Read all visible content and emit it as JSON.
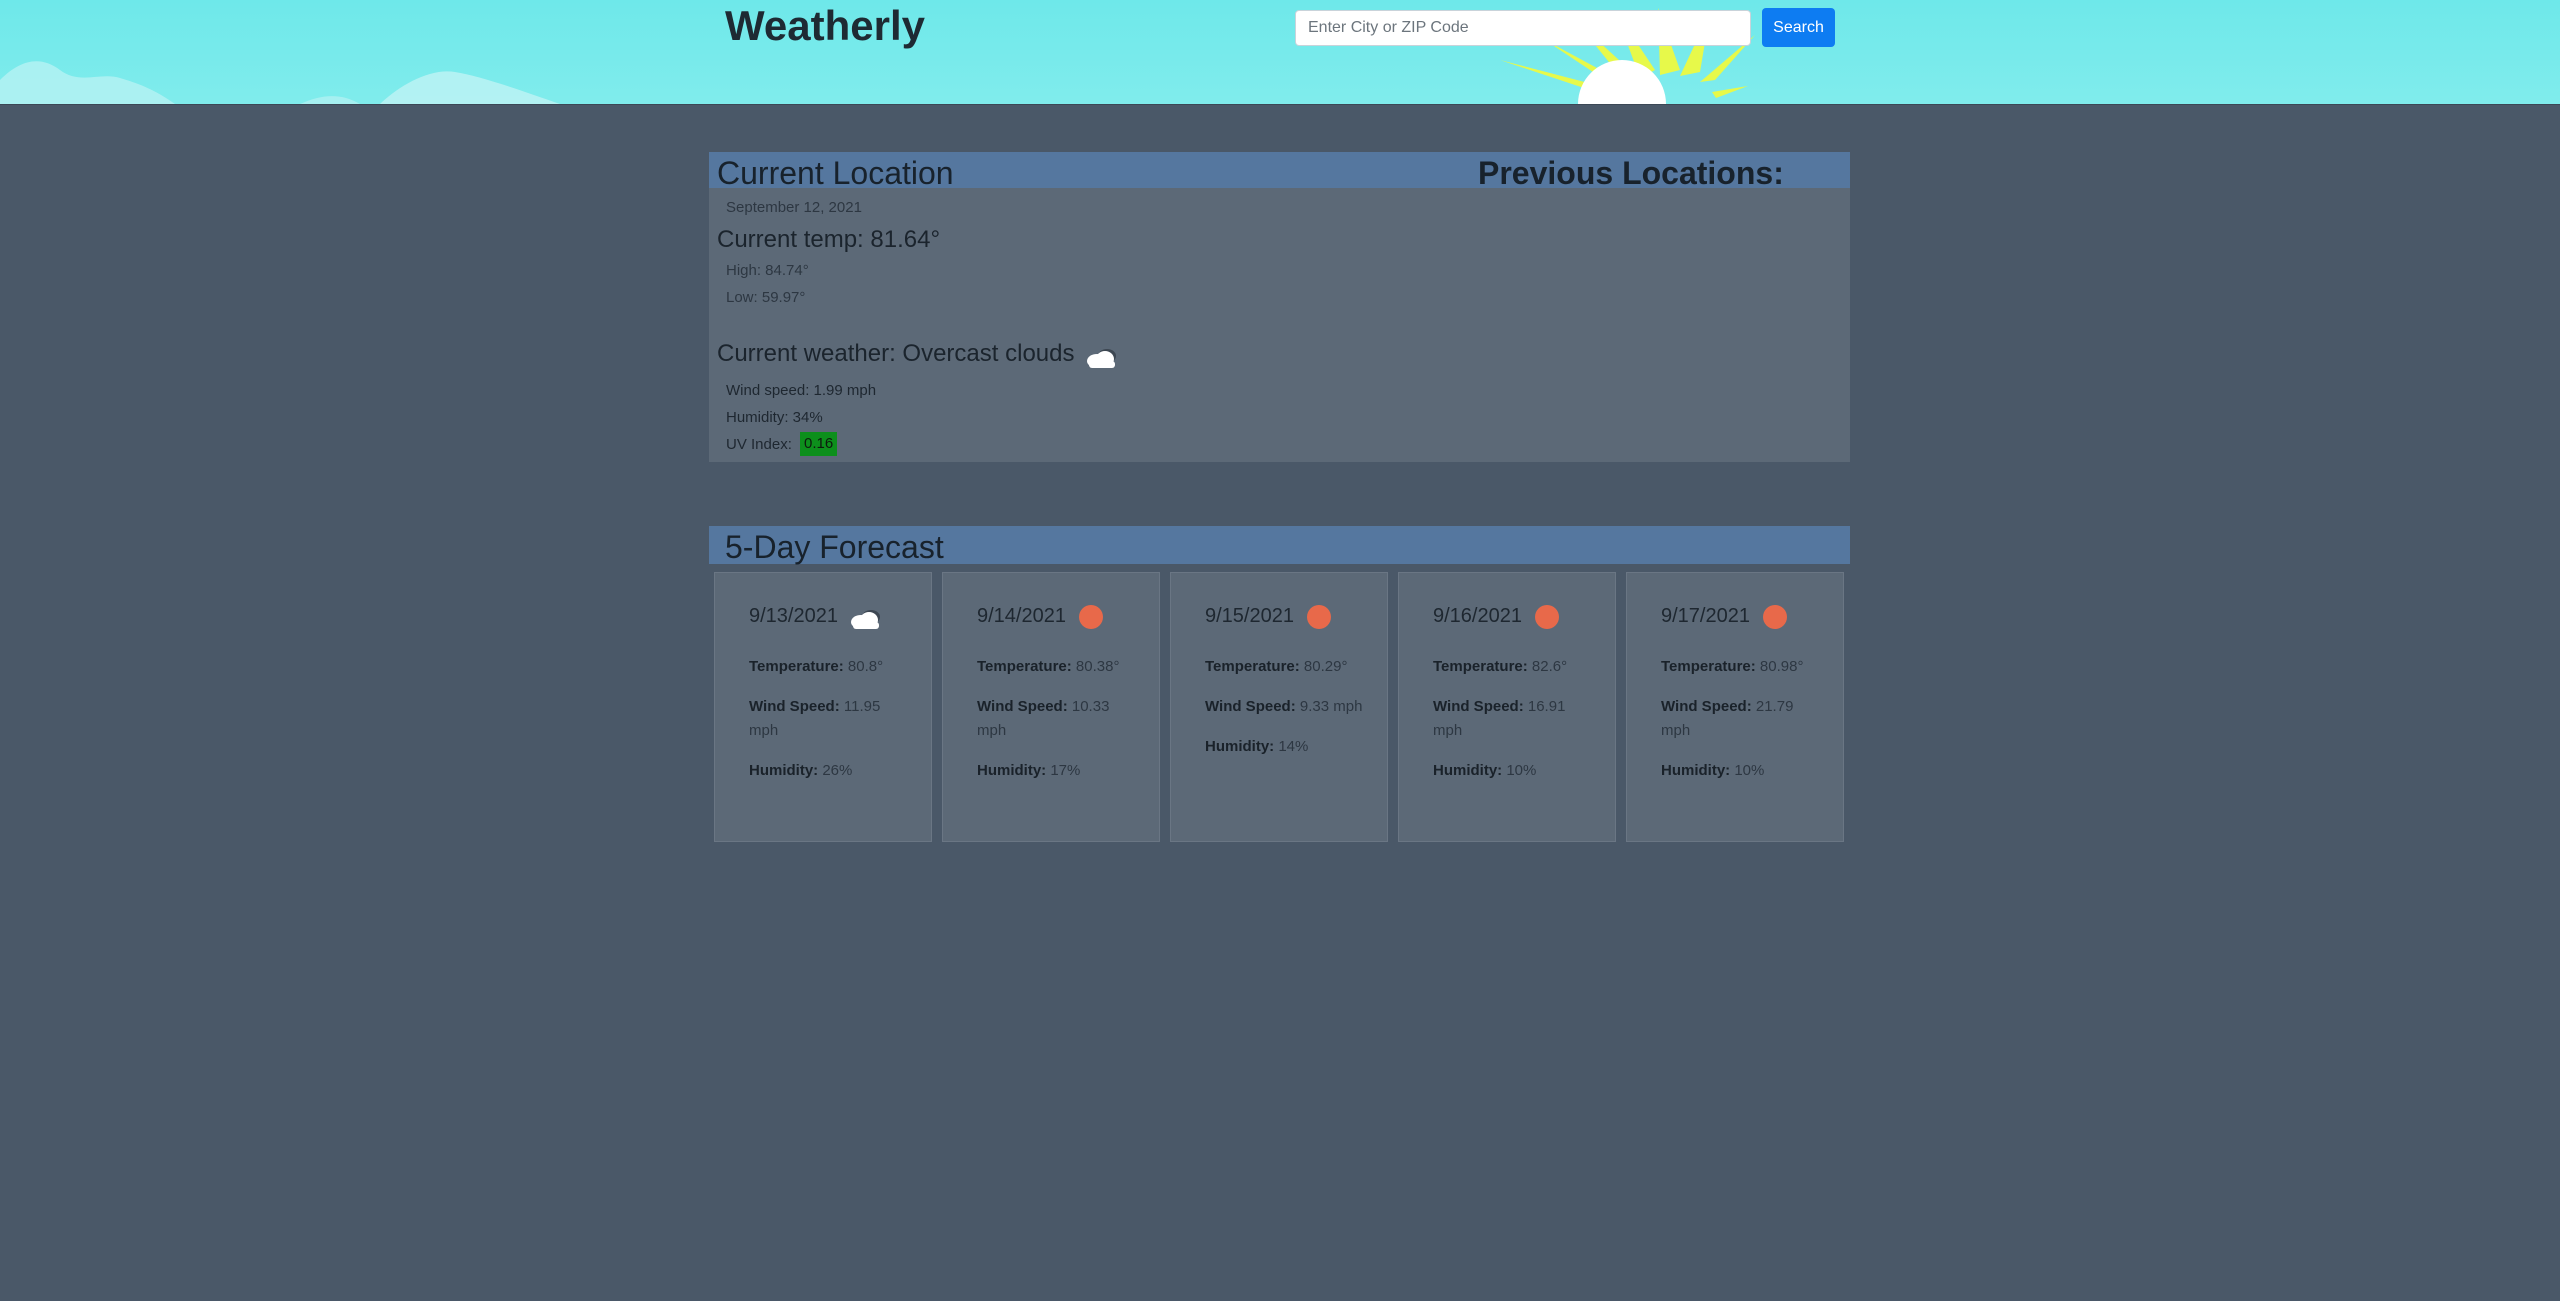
{
  "header": {
    "brand": "Weatherly",
    "search_placeholder": "Enter City or ZIP Code",
    "search_button": "Search"
  },
  "current": {
    "title": "Current Location",
    "previous_title": "Previous Locations:",
    "date": "September 12, 2021",
    "temp": "Current temp: 81.64°",
    "high": "High: 84.74°",
    "low": "Low: 59.97°",
    "weather": "Current weather: Overcast clouds",
    "weather_icon": "cloud-icon",
    "wind": "Wind speed: 1.99 mph",
    "humidity": "Humidity: 34%",
    "uv_label": "UV Index:",
    "uv_value": "0.16",
    "uv_color": "#0d8f1c"
  },
  "forecast": {
    "title": "5-Day Forecast",
    "temp_label": "Temperature:",
    "wind_label": "Wind Speed:",
    "humidity_label": "Humidity:",
    "days": [
      {
        "date": "9/13/2021",
        "icon": "cloud-icon",
        "temp": "80.8°",
        "wind": "11.95 mph",
        "humidity": "26%"
      },
      {
        "date": "9/14/2021",
        "icon": "sun-icon",
        "temp": "80.38°",
        "wind": "10.33 mph",
        "humidity": "17%"
      },
      {
        "date": "9/15/2021",
        "icon": "sun-icon",
        "temp": "80.29°",
        "wind": "9.33 mph",
        "humidity": "14%"
      },
      {
        "date": "9/16/2021",
        "icon": "sun-icon",
        "temp": "82.6°",
        "wind": "16.91 mph",
        "humidity": "10%"
      },
      {
        "date": "9/17/2021",
        "icon": "sun-icon",
        "temp": "80.98°",
        "wind": "21.79 mph",
        "humidity": "10%"
      }
    ]
  },
  "colors": {
    "header_bg": "#6ee8ea",
    "page_bg": "#4a5868",
    "section_bar": "#55779f",
    "panel_bg": "#5c6977",
    "search_button": "#0d7cf2",
    "sun_dot": "#e8694a"
  }
}
